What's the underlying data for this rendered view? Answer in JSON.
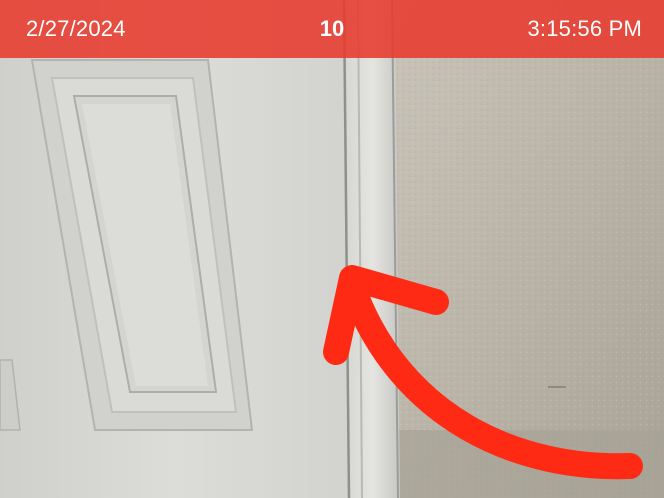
{
  "status_bar": {
    "date": "2/27/2024",
    "count": "10",
    "time": "3:15:56 PM",
    "color": "#E83A2D"
  },
  "annotation": {
    "icon": "curved-arrow-icon",
    "color": "#FF2A14"
  },
  "colors": {
    "door": "#D9DAD6",
    "wall": "#B9B3A7",
    "trim": "#E1E1DC"
  }
}
